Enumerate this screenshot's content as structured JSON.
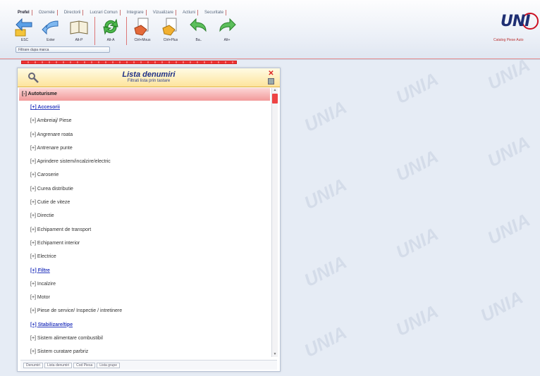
{
  "ribbon": {
    "tabs": [
      "Prefel",
      "Ozerrele",
      "Directorii",
      "Lucrari Comun",
      "Integrare",
      "Vizualizare",
      "Actiuni",
      "Securitate"
    ],
    "tools": [
      {
        "label": "ESC",
        "icon": "escape-icon"
      },
      {
        "label": "Exter",
        "icon": "back-arrow-icon"
      },
      {
        "label": "Alt-P",
        "icon": "book-icon"
      },
      {
        "label": "Alt-A",
        "icon": "refresh-icon"
      },
      {
        "label": "Ctrl+Mous",
        "icon": "document-hand-icon"
      },
      {
        "label": "Ctrl+Plus",
        "icon": "document-add-icon"
      },
      {
        "label": "Ba..",
        "icon": "undo-arrow-icon"
      },
      {
        "label": "Alt+",
        "icon": "redo-arrow-icon"
      }
    ],
    "sub_button": "Filtrare dupa marca",
    "logo_text": "UNI",
    "logo_tagline": "Catalog Piese Auto"
  },
  "colors": {
    "accent_red": "#e33333",
    "header_yellow": "#fde49c",
    "title_blue": "#1c2f86",
    "link_blue": "#2d3dc0"
  },
  "panel": {
    "title": "Lista denumiri",
    "subtitle": "Filtrati lista prin tastare",
    "category": "[-] Autoturisme",
    "items": [
      {
        "label": "[+] Accesorii",
        "link": true
      },
      {
        "label": "[+] Ambreiaj/ Piese",
        "link": false
      },
      {
        "label": "[+] Angrenare roata",
        "link": false
      },
      {
        "label": "[+] Antrenare punte",
        "link": false
      },
      {
        "label": "[+] Aprindere sistem/incalzire/electric",
        "link": false
      },
      {
        "label": "[+] Caroserie",
        "link": false
      },
      {
        "label": "[+] Curea distributie",
        "link": false
      },
      {
        "label": "[+] Cutie de viteze",
        "link": false
      },
      {
        "label": "[+] Directie",
        "link": false
      },
      {
        "label": "[+] Echipament de transport",
        "link": false
      },
      {
        "label": "[+] Echipament interior",
        "link": false
      },
      {
        "label": "[+] Electrice",
        "link": false
      },
      {
        "label": "[+] Filtre",
        "link": true
      },
      {
        "label": "[+] Incalzire",
        "link": false
      },
      {
        "label": "[+] Motor",
        "link": false
      },
      {
        "label": "[+] Piese de service/ Inspectie / intretinere",
        "link": false
      },
      {
        "label": "[+] Stabilizare/tipe",
        "link": true
      },
      {
        "label": "[+] Sistem alimentare combustibil",
        "link": false
      },
      {
        "label": "[+] Sistem curatare parbriz",
        "link": false
      }
    ],
    "footer_tabs": [
      "Denumiri",
      "Lista denumiri",
      "Cod Piesa",
      "Lista grupe"
    ]
  },
  "watermark": "UNIA"
}
